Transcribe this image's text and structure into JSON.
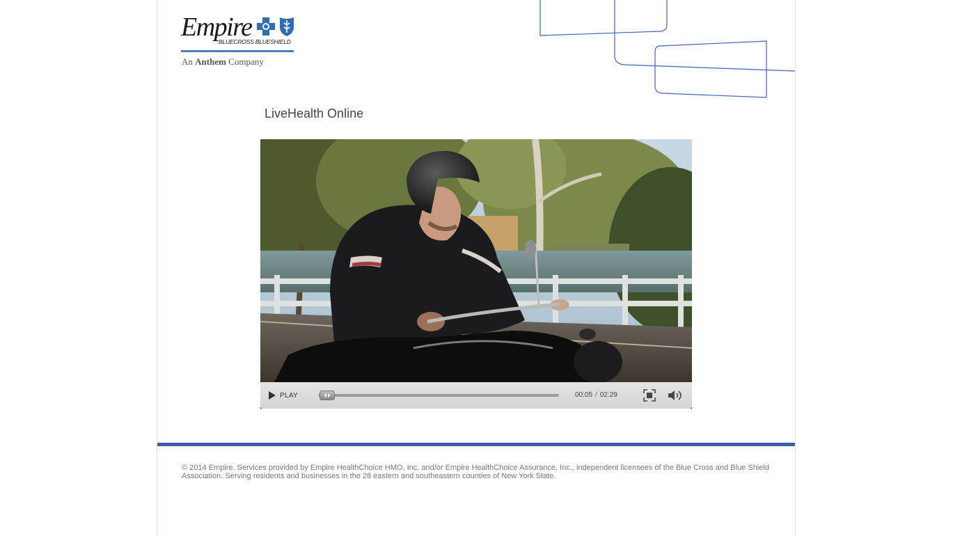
{
  "logo": {
    "brand": "Empire",
    "sub": "BLUECROSS BLUESHIELD",
    "tag_prefix": "An",
    "tag_bold": "Anthem",
    "tag_suffix": "Company",
    "brand_color": "#4c7fc1"
  },
  "page": {
    "title": "LiveHealth Online"
  },
  "player": {
    "play_label": "PLAY",
    "current_time": "00:05",
    "separator": "/",
    "duration": "02:29",
    "progress_fraction": 0.034,
    "icons": {
      "play": "play-icon",
      "fullscreen": "fullscreen-icon",
      "volume": "volume-icon"
    }
  },
  "footer": {
    "legal": "© 2014 Empire. Services provided by Empire HealthChoice HMO, Inc. and/or Empire HealthChoice Assurance, Inc., independent licensees of the Blue Cross and Blue Shield Association. Serving residents and businesses in the 28 eastern and southeastern counties of New York State.",
    "rule_color": "#3d5da8"
  }
}
